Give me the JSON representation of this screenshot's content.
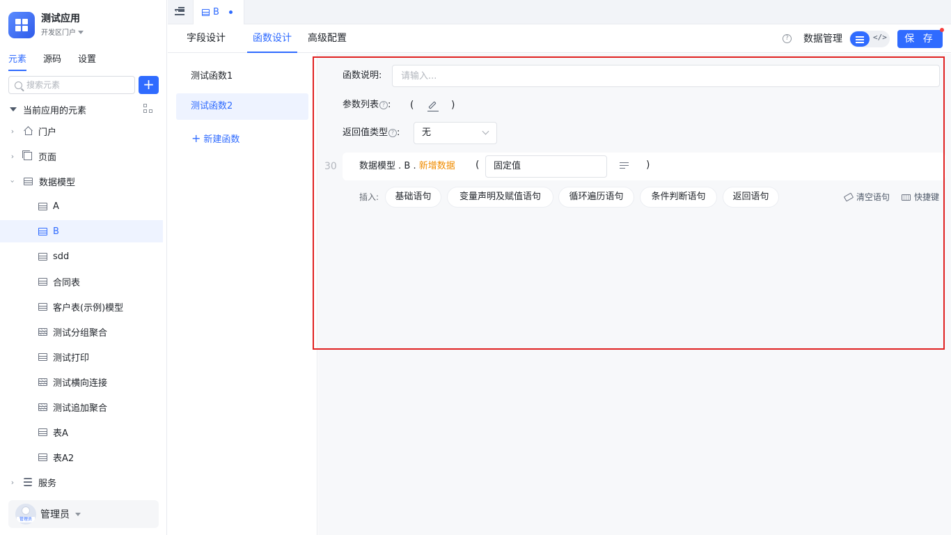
{
  "app": {
    "name": "测试应用",
    "portal": "开发区门户"
  },
  "sidebar": {
    "tabs": [
      "元素",
      "源码",
      "设置"
    ],
    "search_placeholder": "搜索元素",
    "add_label": "+",
    "root_label": "当前应用的元素",
    "items": {
      "portal": "门户",
      "page": "页面",
      "model": "数据模型",
      "m_a": "A",
      "m_b": "B",
      "m_sdd": "sdd",
      "m_contract": "合同表",
      "m_customer": "客户表(示例)模型",
      "m_group": "测试分组聚合",
      "m_print": "测试打印",
      "m_join": "测试横向连接",
      "m_append": "测试追加聚合",
      "m_tablea": "表A",
      "m_tablea2": "表A2",
      "service": "服务"
    },
    "user": {
      "name": "管理员",
      "avatar_tag": "管理员"
    }
  },
  "topbar": {
    "open_tab": "B"
  },
  "design_tabs": [
    "字段设计",
    "函数设计",
    "高级配置"
  ],
  "header": {
    "data_mgmt": "数据管理",
    "save_label": "保 存",
    "code_label": "</>"
  },
  "functions": {
    "items": [
      "测试函数1",
      "测试函数2"
    ],
    "new_label": "新建函数"
  },
  "editor": {
    "desc_label": "函数说明:",
    "desc_placeholder": "请输入...",
    "params_label": "参数列表",
    "params_colon": ":",
    "paren_open": "(",
    "paren_close": ")",
    "return_label": "返回值类型",
    "return_colon": ":",
    "return_value": "无",
    "line_number": "30",
    "stmt_prefix": "数据模型 . B . ",
    "stmt_action": "新增数据",
    "stmt_value": "固定值",
    "insert_label": "插入:",
    "chips": [
      "基础语句",
      "变量声明及赋值语句",
      "循环遍历语句",
      "条件判断语句",
      "返回语句"
    ],
    "clear_label": "清空语句",
    "shortcut_label": "快捷键"
  },
  "colors": {
    "accent": "#2f6bff",
    "action": "#f08c00",
    "highlight": "#e02020"
  }
}
